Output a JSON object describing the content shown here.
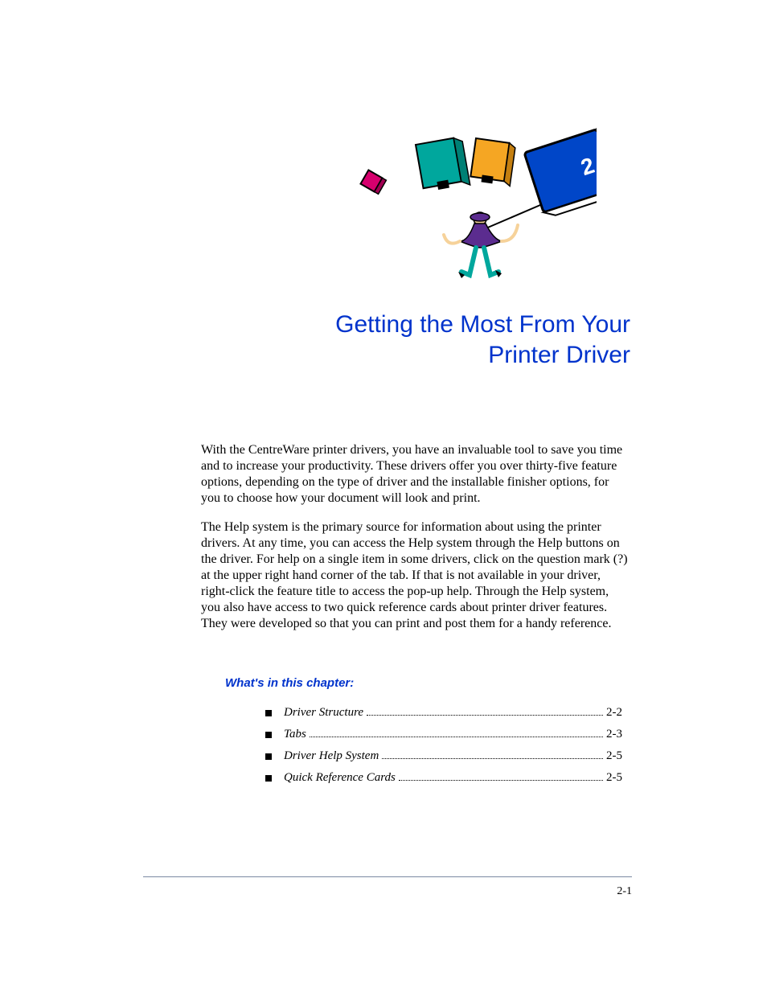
{
  "chapter": {
    "number": "2",
    "title_line1": "Getting the Most From Your",
    "title_line2": "Printer Driver"
  },
  "paragraphs": {
    "p1": "With the CentreWare printer drivers, you have an invaluable tool to save you time and to increase your productivity. These drivers offer you over thirty-five feature options, depending on the type of driver and the installable finisher options, for you to choose how your document will look and print.",
    "p2": "The Help system is the primary source for information about using the printer drivers. At any time, you can access the Help system through the Help buttons on the driver. For help on a single item in some drivers, click on the question mark (?) at the upper right hand corner of the tab. If that is not available in your driver, right-click the feature title to access the pop-up help. Through the Help system, you also have access to two quick reference cards about printer driver features. They were developed so that you can print and post them for a handy reference."
  },
  "section_header": "What's in this chapter:",
  "toc": [
    {
      "label": "Driver Structure",
      "page": "2-2"
    },
    {
      "label": "Tabs",
      "page": "2-3"
    },
    {
      "label": "Driver Help System",
      "page": "2-5"
    },
    {
      "label": "Quick Reference Cards",
      "page": "2-5"
    }
  ],
  "footer": {
    "page_number": "2-1"
  }
}
